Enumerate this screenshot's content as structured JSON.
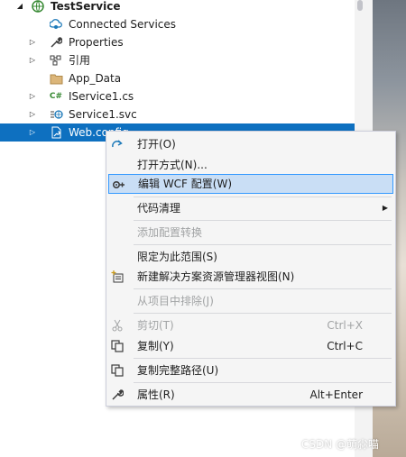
{
  "solution_explorer": {
    "items": [
      {
        "label": "TestService",
        "icon": "globe-project-icon"
      },
      {
        "label": "Connected Services",
        "icon": "connected-services-icon"
      },
      {
        "label": "Properties",
        "icon": "wrench-icon"
      },
      {
        "label": "引用",
        "icon": "references-icon"
      },
      {
        "label": "App_Data",
        "icon": "folder-icon"
      },
      {
        "label": "IService1.cs",
        "icon": "csharp-file-icon"
      },
      {
        "label": "Service1.svc",
        "icon": "svc-file-icon"
      },
      {
        "label": "Web.config",
        "icon": "config-file-icon"
      }
    ],
    "csharp_badge": "C#"
  },
  "context_menu": {
    "open": {
      "label": "打开(O)"
    },
    "open_with": {
      "label": "打开方式(N)..."
    },
    "edit_wcf": {
      "label": "编辑 WCF 配置(W)"
    },
    "code_cleanup": {
      "label": "代码清理"
    },
    "add_config_transform": {
      "label": "添加配置转换"
    },
    "scope_to_this": {
      "label": "限定为此范围(S)"
    },
    "new_explorer_view": {
      "label": "新建解决方案资源管理器视图(N)"
    },
    "exclude_from_project": {
      "label": "从项目中排除(J)"
    },
    "cut": {
      "label": "剪切(T)",
      "shortcut": "Ctrl+X"
    },
    "copy": {
      "label": "复制(Y)",
      "shortcut": "Ctrl+C"
    },
    "copy_full_path": {
      "label": "复制完整路径(U)"
    },
    "properties": {
      "label": "属性(R)",
      "shortcut": "Alt+Enter"
    }
  },
  "watermark": "CSDN @萌尛喵",
  "colors": {
    "selection": "#0e70c0",
    "menu_highlight": "#c9def5",
    "menu_highlight_border": "#3399ff",
    "disabled_text": "#a2a4a5"
  }
}
